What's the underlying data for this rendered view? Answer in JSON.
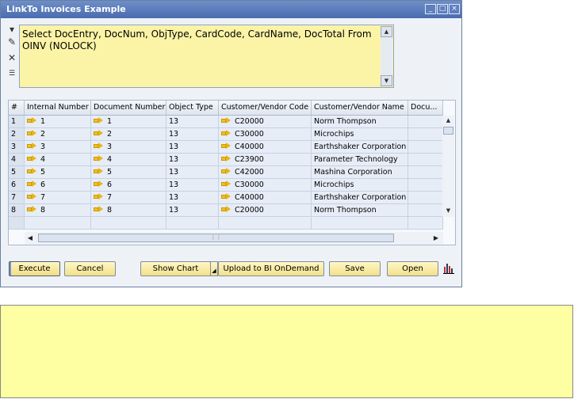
{
  "window": {
    "title": "LinkTo Invoices Example",
    "controls": [
      "_",
      "□",
      "×"
    ]
  },
  "toolbar": {
    "icons": [
      "dropdown-arrow-icon",
      "pencil-icon",
      "clear-icon",
      "options-list-icon"
    ]
  },
  "query": {
    "text": "Select DocEntry, DocNum, ObjType, CardCode, CardName, DocTotal From\nOINV (NOLOCK)"
  },
  "grid": {
    "headers": [
      "#",
      "Internal Number",
      "Document Number",
      "Object Type",
      "Customer/Vendor Code",
      "Customer/Vendor Name",
      "Docu..."
    ],
    "rows": [
      {
        "n": "1",
        "internal": "1",
        "doc": "1",
        "type": "13",
        "code": "C20000",
        "name": "Norm Thompson"
      },
      {
        "n": "2",
        "internal": "2",
        "doc": "2",
        "type": "13",
        "code": "C30000",
        "name": "Microchips"
      },
      {
        "n": "3",
        "internal": "3",
        "doc": "3",
        "type": "13",
        "code": "C40000",
        "name": "Earthshaker Corporation"
      },
      {
        "n": "4",
        "internal": "4",
        "doc": "4",
        "type": "13",
        "code": "C23900",
        "name": "Parameter Technology"
      },
      {
        "n": "5",
        "internal": "5",
        "doc": "5",
        "type": "13",
        "code": "C42000",
        "name": "Mashina Corporation"
      },
      {
        "n": "6",
        "internal": "6",
        "doc": "6",
        "type": "13",
        "code": "C30000",
        "name": "Microchips"
      },
      {
        "n": "7",
        "internal": "7",
        "doc": "7",
        "type": "13",
        "code": "C40000",
        "name": "Earthshaker Corporation"
      },
      {
        "n": "8",
        "internal": "8",
        "doc": "8",
        "type": "13",
        "code": "C20000",
        "name": "Norm Thompson"
      }
    ]
  },
  "buttons": {
    "execute": "Execute",
    "cancel": "Cancel",
    "show_chart": "Show Chart",
    "upload": "Upload to BI OnDemand",
    "save": "Save",
    "open": "Open"
  },
  "colors": {
    "title_bar": "#4a6cae",
    "query_bg": "#fbf4a6",
    "panel_bg": "#fefea2",
    "button_bg": "#f2e08a"
  }
}
